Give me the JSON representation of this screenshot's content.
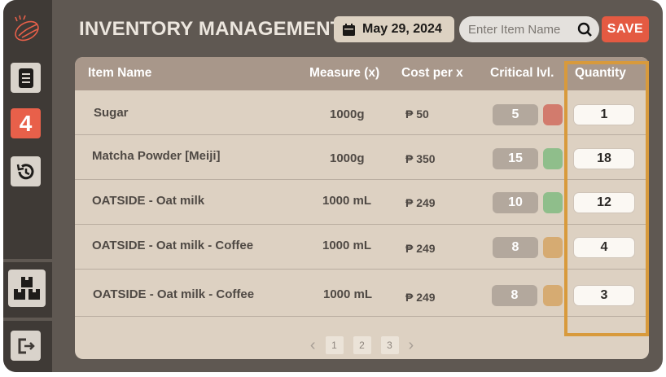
{
  "header": {
    "title": "INVENTORY MANAGEMENT",
    "date": "May 29, 2024",
    "search_placeholder": "Enter Item Name",
    "save_label": "SAVE"
  },
  "sidebar": {
    "active_badge": "4",
    "items": [
      {
        "icon": "receipt-icon"
      },
      {
        "icon": "inventory-number-icon",
        "label": "4"
      },
      {
        "icon": "history-icon"
      },
      {
        "icon": "boxes-icon"
      },
      {
        "icon": "logout-icon"
      }
    ]
  },
  "table": {
    "columns": [
      "Item Name",
      "Measure (x)",
      "Cost per x",
      "Critical lvl.",
      "Quantity"
    ],
    "rows": [
      {
        "name": "Sugar",
        "measure": "1000g",
        "cost": "₱ 50",
        "critical": "5",
        "status_color": "#d27b6d",
        "quantity": "1"
      },
      {
        "name": "Matcha Powder [Meiji]",
        "measure": "1000g",
        "cost": "₱ 350",
        "critical": "15",
        "status_color": "#8fbe8b",
        "quantity": "18"
      },
      {
        "name": "OATSIDE - Oat milk",
        "measure": "1000 mL",
        "cost": "₱ 249",
        "critical": "10",
        "status_color": "#8fbe8b",
        "quantity": "12"
      },
      {
        "name": "OATSIDE - Oat milk - Coffee",
        "measure": "1000 mL",
        "cost": "₱ 249",
        "critical": "8",
        "status_color": "#d6ab72",
        "quantity": "4"
      },
      {
        "name": "OATSIDE - Oat milk - Coffee",
        "measure": "1000 mL",
        "cost": "₱ 249",
        "critical": "8",
        "status_color": "#d6ab72",
        "quantity": "3"
      }
    ]
  },
  "pagination": {
    "prev": "‹",
    "pages": [
      "1",
      "2",
      "3"
    ],
    "next": "›"
  },
  "colors": {
    "accent": "#e45a42",
    "highlight": "#d89a3c",
    "header_bg": "#a8978a",
    "app_bg": "#5f5852",
    "sidebar_bg": "#3f3a36"
  }
}
